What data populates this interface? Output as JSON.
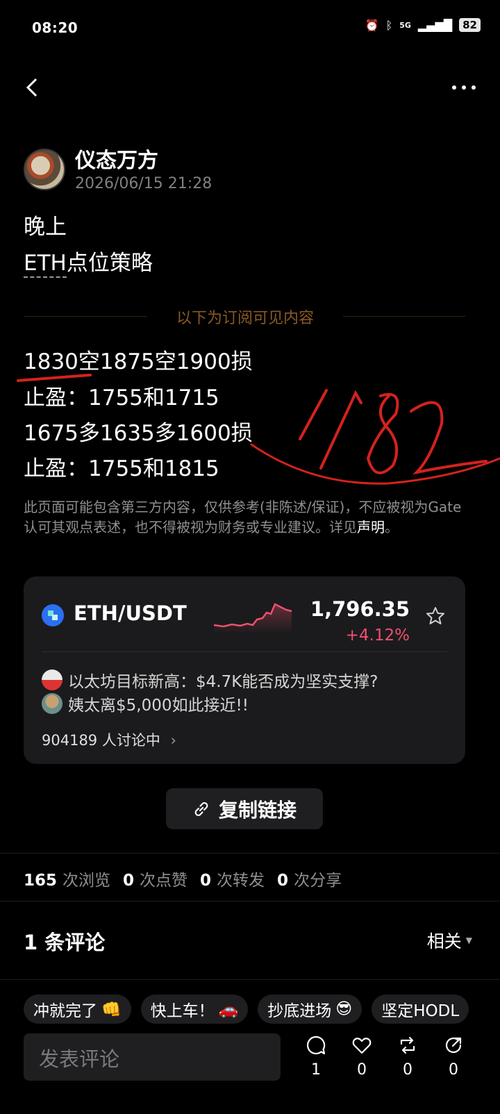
{
  "status": {
    "time": "08:20",
    "network": "5G",
    "battery": "82"
  },
  "post": {
    "author": "仪态万方",
    "date": "2026/06/15 21:28",
    "line1": "晚上",
    "line2_eth": "ETH",
    "line2_rest": "点位策略",
    "subscribe_divider": "以下为订阅可见内容",
    "lines": [
      "1830空1875空1900损",
      "止盈：1755和1715",
      "1675多1635多1600损",
      "止盈：1755和1815"
    ],
    "handwriting": "1782",
    "disclaimer": "此页面可能包含第三方内容，仅供参考(非陈述/保证)，不应被视为Gate认可其观点表述，也不得被视为财务或专业建议。详见",
    "disclaimer_link": "声明",
    "disclaimer_end": "。"
  },
  "market": {
    "pair": "ETH/USDT",
    "price": "1,796.35",
    "change": "+4.12%",
    "topics": [
      "以太坊目标新高：$4.7K能否成为坚实支撑?",
      "姨太离$5,000如此接近!!"
    ],
    "discussing": "904189 人讨论中",
    "accent_up": "#f0506e"
  },
  "copy_link": "复制链接",
  "stats": {
    "views": "165",
    "views_label": "次浏览",
    "likes": "0",
    "likes_label": "次点赞",
    "reposts": "0",
    "reposts_label": "次转发",
    "shares": "0",
    "shares_label": "次分享"
  },
  "comments": {
    "title": "1 条评论",
    "sort": "相关"
  },
  "chips": [
    {
      "label": "冲就完了",
      "emoji": "👊"
    },
    {
      "label": "快上车！",
      "emoji": "🚗"
    },
    {
      "label": "抄底进场",
      "emoji": "😎"
    },
    {
      "label": "坚定HODL",
      "emoji": ""
    }
  ],
  "bottom": {
    "placeholder": "发表评论",
    "comment_count": "1",
    "like_count": "0",
    "repost_count": "0",
    "share_count": "0"
  }
}
